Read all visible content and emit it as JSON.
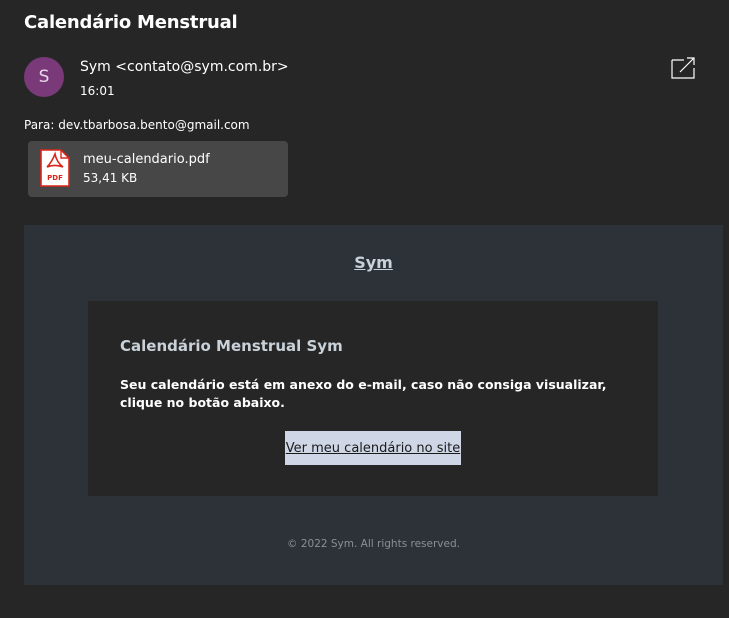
{
  "email": {
    "subject": "Calendário Menstrual",
    "avatar_initial": "S",
    "sender": "Sym <contato@sym.com.br>",
    "time": "16:01",
    "to": "Para: dev.tbarbosa.bento@gmail.com",
    "popout_icon": "open-in-new-window-icon"
  },
  "attachment": {
    "icon": "pdf-file-icon",
    "icon_label": "PDF",
    "name": "meu-calendario.pdf",
    "size": "53,41 KB"
  },
  "body": {
    "brand": "Sym",
    "card_title": "Calendário Menstrual Sym",
    "card_text": "Seu calendário está em anexo do e-mail, caso não consiga visualizar, clique no botão abaixo.",
    "button_label": "Ver meu calendário no site",
    "footer": "© 2022 Sym. All rights reserved."
  },
  "colors": {
    "background": "#262626",
    "avatar": "#7a3a7a",
    "attachment_bg": "#474747",
    "email_body_bg": "#2c3237",
    "card_bg": "#262626",
    "button_bg": "#cfd6e6",
    "pdf_red": "#d9261c"
  }
}
